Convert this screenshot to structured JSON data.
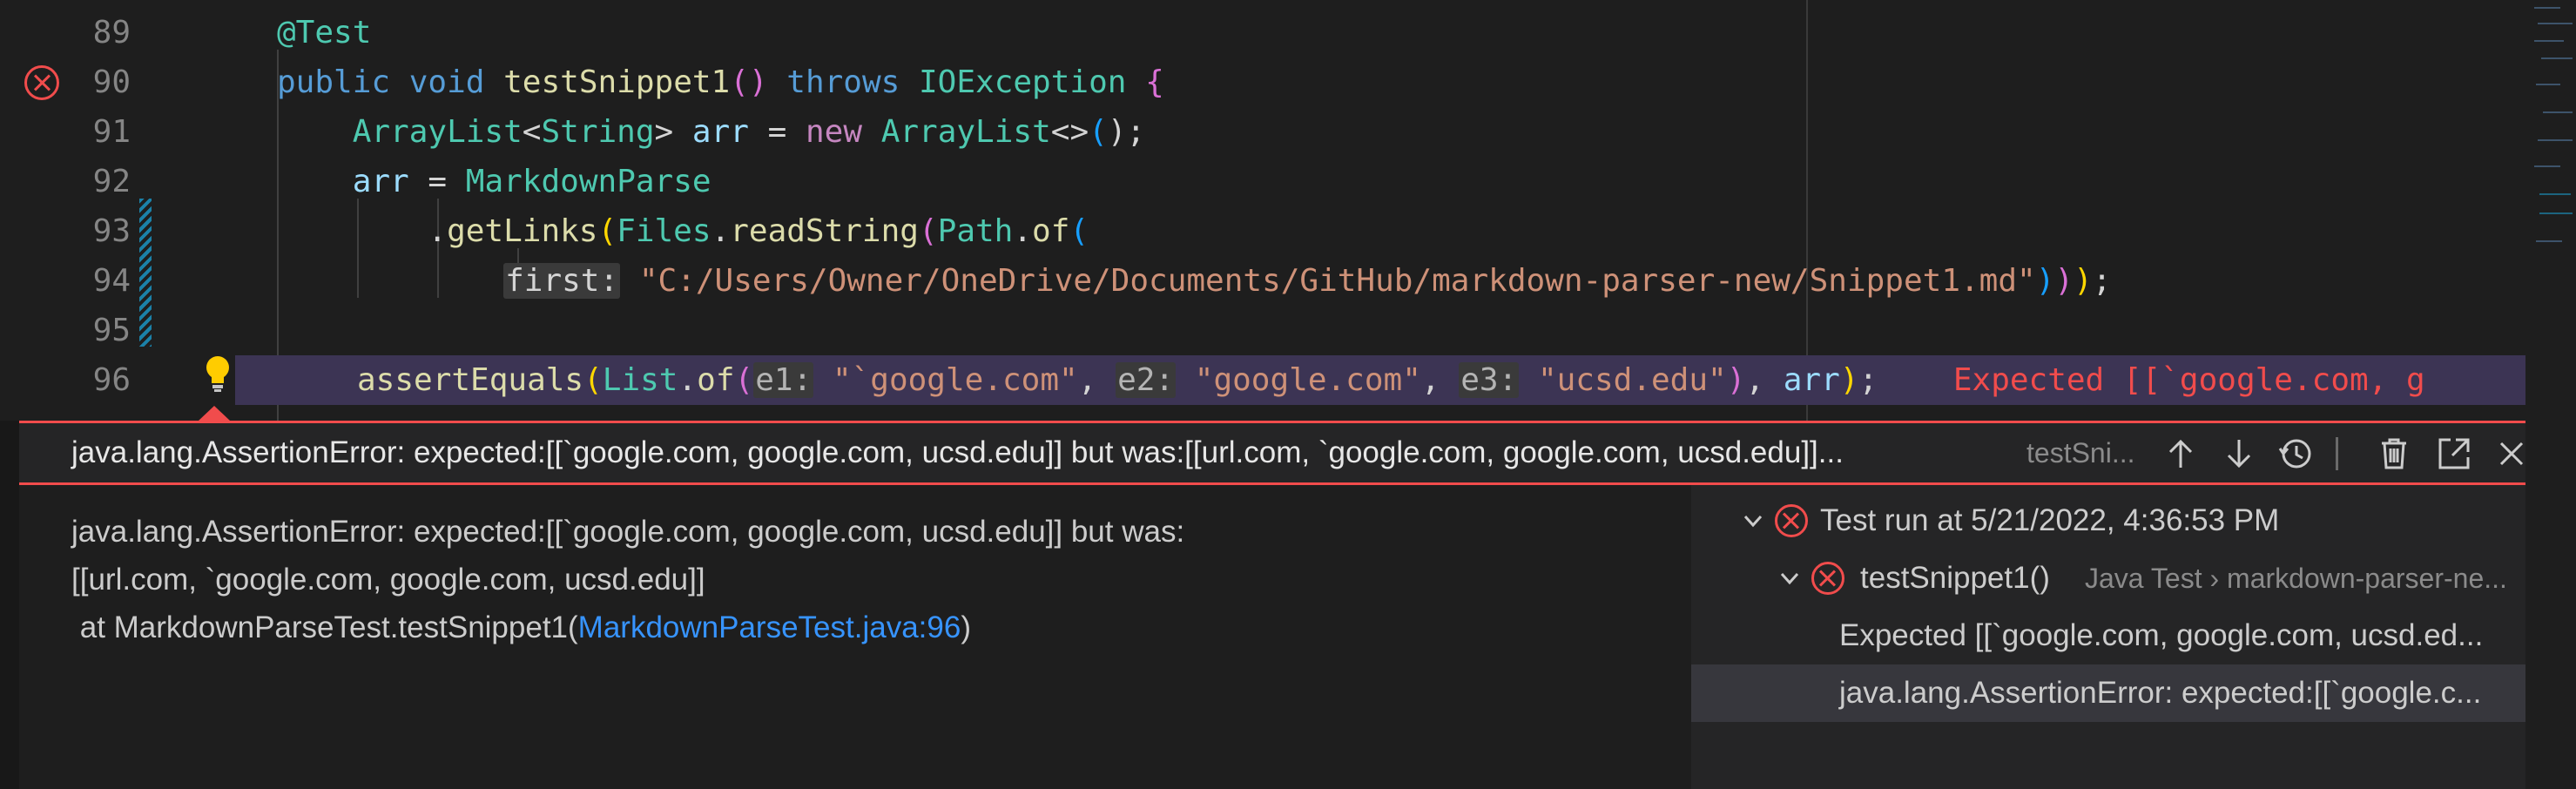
{
  "editor": {
    "lines": [
      {
        "num": "89",
        "annotation": "@Test"
      },
      {
        "num": "90",
        "mod": "public",
        "type": "void",
        "name": "testSnippet1",
        "parens": "()",
        "throws": "throws",
        "exc": "IOException",
        "brace": "{"
      },
      {
        "num": "91",
        "t1": "ArrayList",
        "t2": "String",
        "var": "arr",
        "op": "=",
        "kw": "new",
        "ctor": "ArrayList",
        "diamond": "<>",
        "tail": ");"
      },
      {
        "num": "92",
        "var": "arr",
        "op": "=",
        "cls": "MarkdownParse"
      },
      {
        "num": "93",
        "dot": ".",
        "m1": "getLinks",
        "cls": "Files",
        "m2": "readString",
        "cls2": "Path",
        "m3": "of"
      },
      {
        "num": "94",
        "hint": "first:",
        "str": "\"C:/Users/Owner/OneDrive/Documents/GitHub/markdown-parser-new/Snippet1.md\"",
        "tail": ")));"
      },
      {
        "num": "95"
      },
      {
        "num": "96",
        "fn": "assertEquals",
        "cls": "List",
        "m": "of",
        "h1": "e1:",
        "s1": "\"`google.com\"",
        "h2": "e2:",
        "s2": "\"google.com\"",
        "h3": "e3:",
        "s3": "\"ucsd.edu\"",
        "var": "arr",
        "tail": ");",
        "inline_error": "Expected [[`google.com, g"
      }
    ]
  },
  "peek": {
    "title": "java.lang.AssertionError: expected:[[`google.com, google.com, ucsd.edu]] but was:[[url.com, `google.com, google.com, ucsd.edu]]...",
    "subtitle": "testSni...",
    "message_line1": "java.lang.AssertionError: expected:[[`google.com, google.com, ucsd.edu]] but was:",
    "message_line2": "[[url.com, `google.com, google.com, ucsd.edu]]",
    "message_line3_prefix": " at MarkdownParseTest.testSnippet1(",
    "message_link": "MarkdownParseTest.java:96",
    "message_line3_suffix": ")"
  },
  "tree": {
    "run": "Test run at 5/21/2022, 4:36:53 PM",
    "test_name": "testSnippet1()",
    "test_detail": "Java Test › markdown-parser-ne...",
    "expected": "Expected [[`google.com, google.com, ucsd.ed...",
    "assertion": "java.lang.AssertionError: expected:[[`google.c..."
  },
  "colors": {
    "error": "#f14c4c",
    "link": "#3794ff",
    "accent": "#1b81a8"
  }
}
